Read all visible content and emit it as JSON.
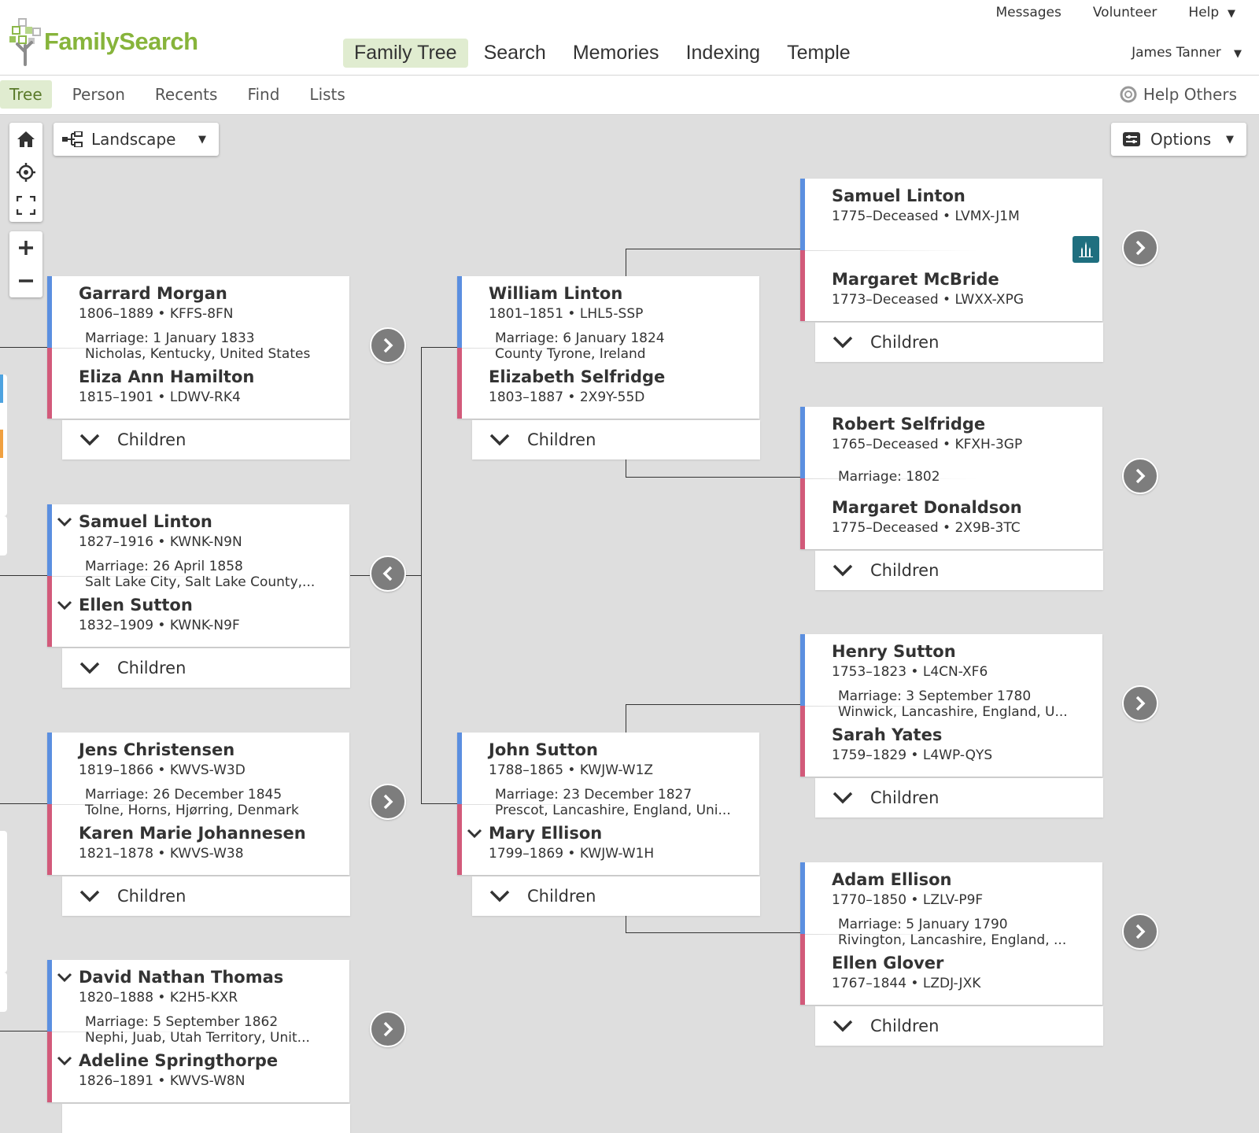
{
  "header": {
    "logo_text": "FamilySearch",
    "util_nav": [
      "Messages",
      "Volunteer",
      "Help"
    ],
    "main_nav": [
      "Family Tree",
      "Search",
      "Memories",
      "Indexing",
      "Temple"
    ],
    "user": "James Tanner"
  },
  "subnav": {
    "items": [
      "Tree",
      "Person",
      "Recents",
      "Find",
      "Lists"
    ],
    "help_others": "Help Others"
  },
  "canvas": {
    "view_label": "Landscape",
    "options_label": "Options",
    "children_label": "Children"
  },
  "couples": [
    {
      "husband": {
        "name": "Garrard Morgan",
        "meta": "1806–1889 • KFFS-8FN"
      },
      "marriage": [
        "Marriage: 1 January 1833",
        "Nicholas, Kentucky, United States"
      ],
      "wife": {
        "name": "Eliza Ann Hamilton",
        "meta": "1815–1901 • LDWV-RK4"
      }
    },
    {
      "husband": {
        "name": "Samuel Linton",
        "meta": "1827–1916 • KWNK-N9N"
      },
      "marriage": [
        "Marriage: 26 April 1858",
        "Salt Lake City, Salt Lake County,..."
      ],
      "wife": {
        "name": "Ellen Sutton",
        "meta": "1832–1909 • KWNK-N9F"
      }
    },
    {
      "husband": {
        "name": "Jens Christensen",
        "meta": "1819–1866 • KWVS-W3D"
      },
      "marriage": [
        "Marriage: 26 December 1845",
        "Tolne, Horns, Hjørring, Denmark"
      ],
      "wife": {
        "name": "Karen Marie Johannesen",
        "meta": "1821–1878 • KWVS-W38"
      }
    },
    {
      "husband": {
        "name": "David Nathan Thomas",
        "meta": "1820–1888 • K2H5-KXR"
      },
      "marriage": [
        "Marriage: 5 September 1862",
        "Nephi, Juab, Utah Territory, Unit..."
      ],
      "wife": {
        "name": "Adeline Springthorpe",
        "meta": "1826–1891 • KWVS-W8N"
      }
    },
    {
      "husband": {
        "name": "William Linton",
        "meta": "1801–1851 • LHL5-SSP"
      },
      "marriage": [
        "Marriage: 6 January 1824",
        "County Tyrone, Ireland"
      ],
      "wife": {
        "name": "Elizabeth Selfridge",
        "meta": "1803–1887 • 2X9Y-55D"
      }
    },
    {
      "husband": {
        "name": "John Sutton",
        "meta": "1788–1865 • KWJW-W1Z"
      },
      "marriage": [
        "Marriage: 23 December 1827",
        "Prescot, Lancashire, England, Uni..."
      ],
      "wife": {
        "name": "Mary Ellison",
        "meta": "1799–1869 • KWJW-W1H"
      }
    },
    {
      "husband": {
        "name": "Samuel Linton",
        "meta": "1775–Deceased • LVMX-J1M"
      },
      "marriage": [],
      "wife": {
        "name": "Margaret McBride",
        "meta": "1773–Deceased • LWXX-XPG"
      }
    },
    {
      "husband": {
        "name": "Robert Selfridge",
        "meta": "1765–Deceased • KFXH-3GP"
      },
      "marriage": [
        "Marriage: 1802"
      ],
      "wife": {
        "name": "Margaret Donaldson",
        "meta": "1775–Deceased • 2X9B-3TC"
      }
    },
    {
      "husband": {
        "name": "Henry Sutton",
        "meta": "1753–1823 • L4CN-XF6"
      },
      "marriage": [
        "Marriage: 3 September 1780",
        "Winwick, Lancashire, England, U..."
      ],
      "wife": {
        "name": "Sarah Yates",
        "meta": "1759–1829 • L4WP-QYS"
      }
    },
    {
      "husband": {
        "name": "Adam Ellison",
        "meta": "1770–1850 • LZLV-P9F"
      },
      "marriage": [
        "Marriage: 5 January 1790",
        "Rivington, Lancashire, England, ..."
      ],
      "wife": {
        "name": "Ellen Glover",
        "meta": "1767–1844 • LZDJ-JXK"
      }
    }
  ],
  "colors": {
    "husband_bar": "#5b8fe0",
    "wife_bar": "#d25a7a",
    "brand_green": "#87b43b",
    "active_nav_bg": "#e0ecd0",
    "canvas_bg": "#dedede",
    "temple_badge": "#1f6f7f"
  }
}
